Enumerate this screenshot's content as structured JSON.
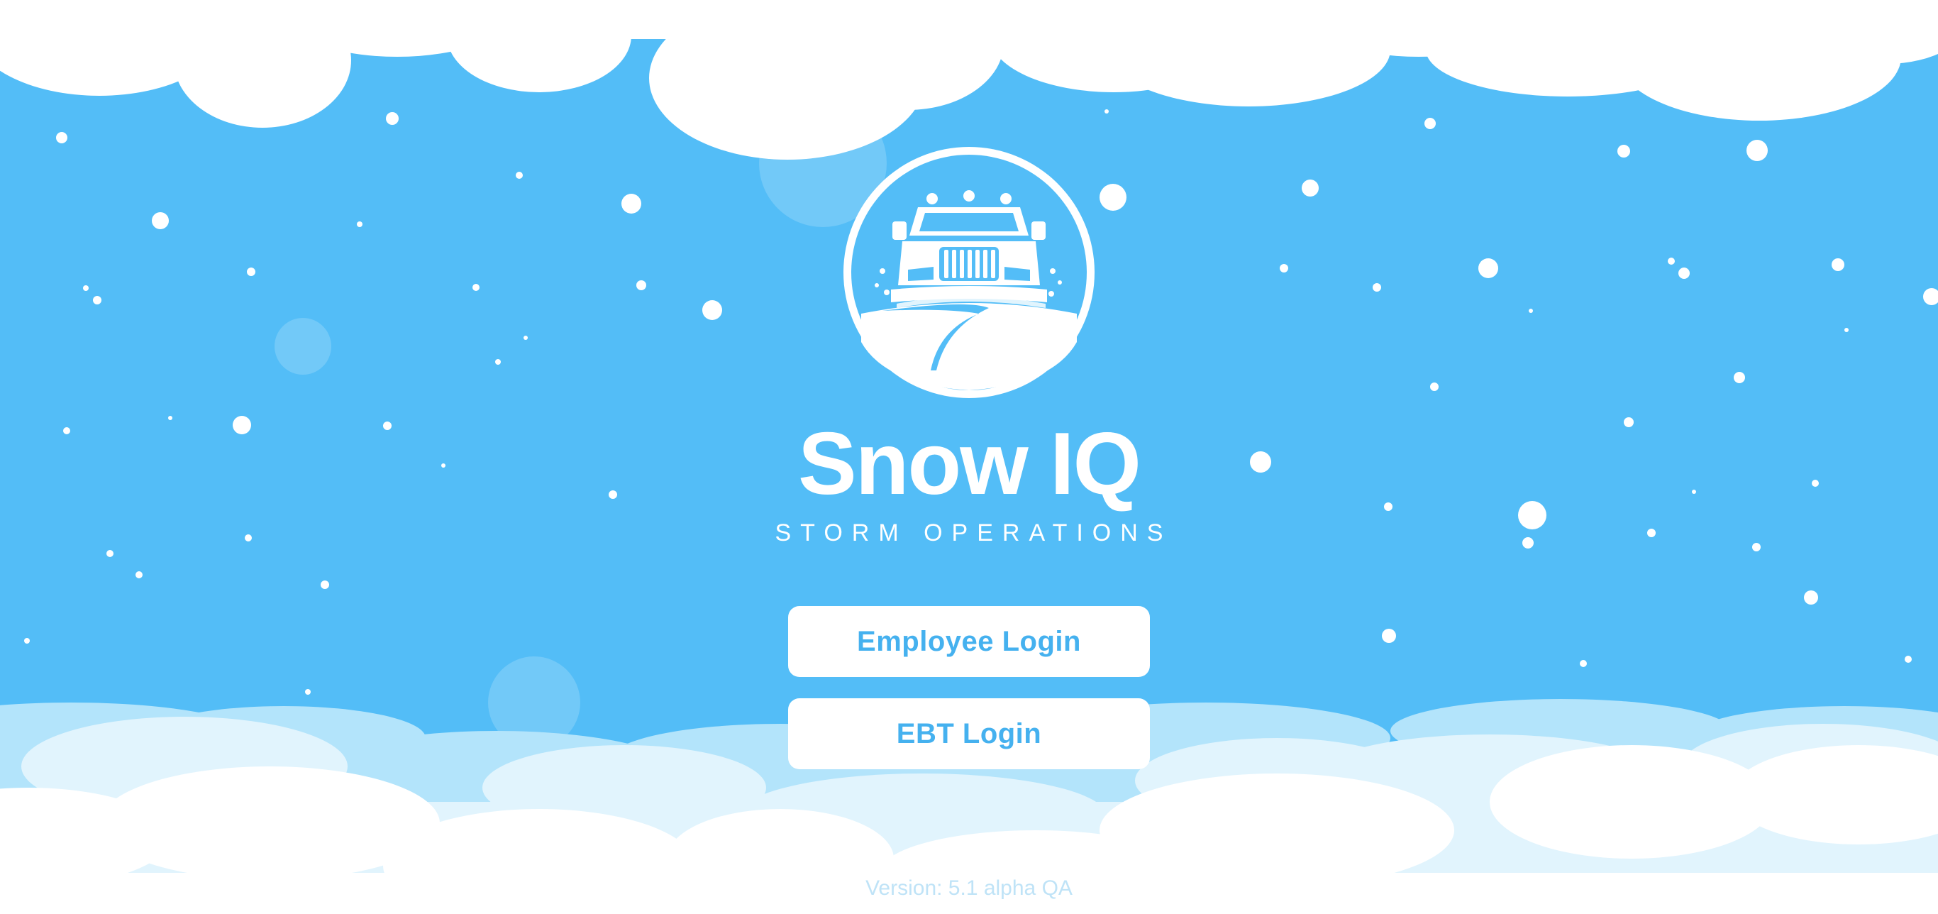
{
  "app": {
    "title": "Snow IQ",
    "subtitle": "STORM OPERATIONS",
    "logo_icon": "snowplow-truck-icon"
  },
  "actions": {
    "employee_login_label": "Employee Login",
    "ebt_login_label": "EBT Login"
  },
  "footer": {
    "version": "Version: 5.1 alpha QA"
  },
  "theme": {
    "sky": "#53bdf7",
    "cloud": "#ffffff",
    "cloud_light": "#e1f4fd",
    "cloud_mid": "#b3e4fb",
    "button_text": "#45b1ef"
  }
}
